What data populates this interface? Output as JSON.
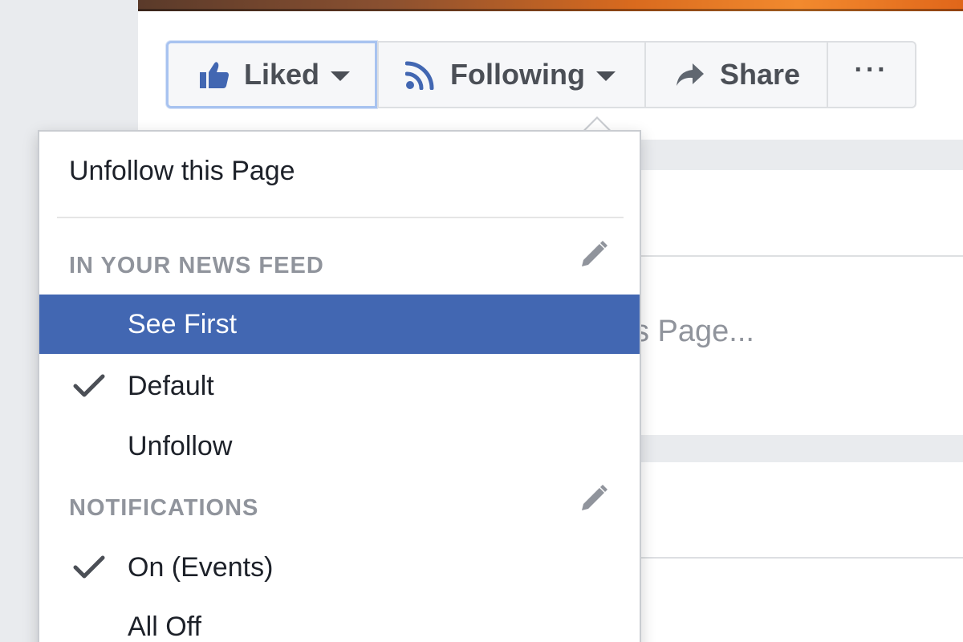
{
  "actions": {
    "liked_label": "Liked",
    "following_label": "Following",
    "share_label": "Share",
    "more_label": "···"
  },
  "background": {
    "partial_text": "s Page..."
  },
  "dropdown": {
    "unfollow_page": "Unfollow this Page",
    "news_feed_header": "IN YOUR NEWS FEED",
    "news_feed_options": [
      {
        "label": "See First",
        "selected_highlight": true,
        "checked": false
      },
      {
        "label": "Default",
        "checked": true
      },
      {
        "label": "Unfollow",
        "checked": false
      }
    ],
    "notifications_header": "NOTIFICATIONS",
    "notification_options": [
      {
        "label": "On (Events)",
        "checked": true
      },
      {
        "label": "All Off",
        "checked": false
      }
    ]
  },
  "icons": {
    "liked": "thumbs-up-icon",
    "following": "rss-feed-icon",
    "share": "share-arrow-icon",
    "edit": "pencil-icon",
    "check": "checkmark-icon"
  },
  "colors": {
    "accent_blue": "#4267b2",
    "liked_icon_blue": "#4267b2",
    "text_dark": "#1d2129",
    "text_muted": "#90949c",
    "button_bg": "#f6f7f9"
  }
}
